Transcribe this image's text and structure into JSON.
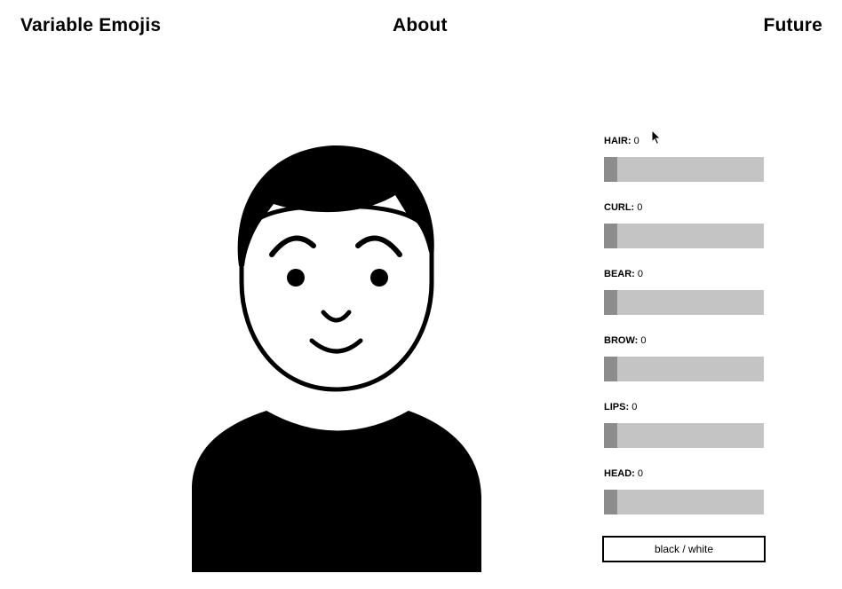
{
  "nav": {
    "brand": "Variable Emojis",
    "about": "About",
    "future": "Future"
  },
  "controls": [
    {
      "name": "HAIR:",
      "value": "0",
      "level": 0
    },
    {
      "name": "CURL:",
      "value": "0",
      "level": 0
    },
    {
      "name": "BEAR:",
      "value": "0",
      "level": 0
    },
    {
      "name": "BROW:",
      "value": "0",
      "level": 0
    },
    {
      "name": "LIPS:",
      "value": "0",
      "level": 0
    },
    {
      "name": "HEAD:",
      "value": "0",
      "level": 0
    }
  ],
  "toggle_button": "black / white",
  "colors": {
    "track": "#c4c4c4",
    "thumb": "#8c8c8c",
    "ink": "#000000",
    "background": "#ffffff"
  }
}
